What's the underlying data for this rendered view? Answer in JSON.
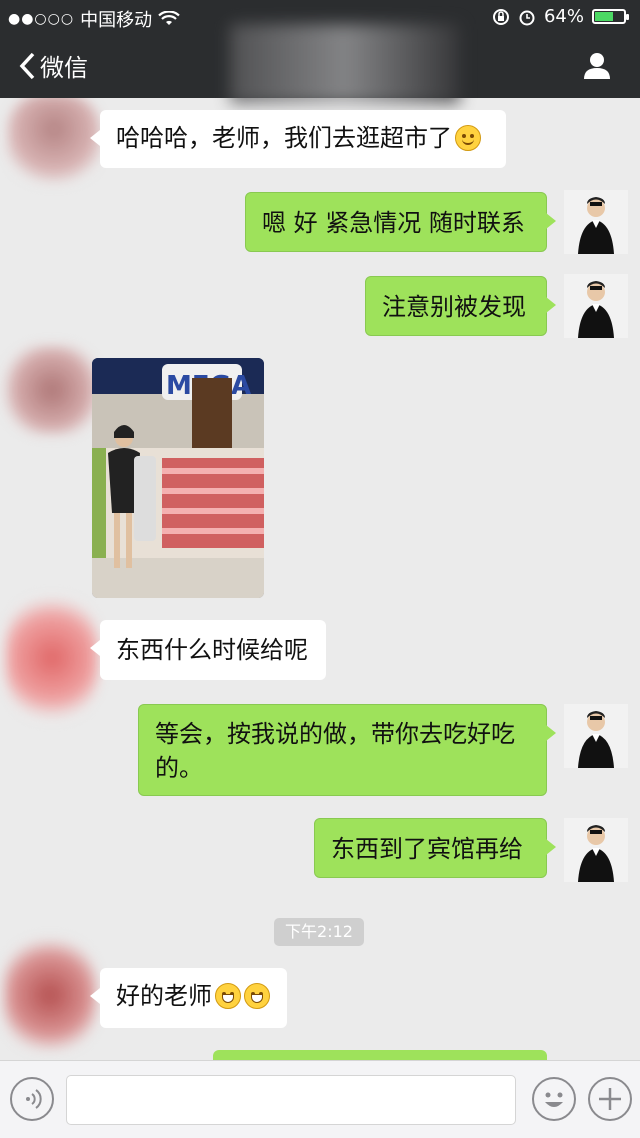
{
  "status": {
    "carrier": "中国移动",
    "time": "",
    "battery": "64%",
    "battery_level": 0.64
  },
  "nav": {
    "back_label": "微信"
  },
  "messages": [
    {
      "from": "them",
      "text": "哈哈哈，老师，我们去逛超市了",
      "emoji": "smile"
    },
    {
      "from": "me",
      "text": "嗯 好 紧急情况 随时联系"
    },
    {
      "from": "me",
      "text": "注意别被发现"
    },
    {
      "from": "them",
      "type": "image",
      "image_text": "MEGA"
    },
    {
      "from": "them",
      "text": "东西什么时候给呢"
    },
    {
      "from": "me",
      "text_line1": "等会，按我说的做，带你去吃好吃",
      "text_line2": "的。"
    },
    {
      "from": "me",
      "text": "东西到了宾馆再给"
    },
    {
      "from": "them",
      "text": "好的老师",
      "emoji": "grin"
    }
  ],
  "timestamp": "下午2:12",
  "colors": {
    "nav_bg": "#2b2d2f",
    "chat_bg": "#ebebeb",
    "outgoing_bubble": "#9ee25b",
    "incoming_bubble": "#ffffff"
  },
  "icons": {
    "back": "chevron-left-icon",
    "profile": "person-icon",
    "voice": "voice-icon",
    "emoji": "emoji-icon",
    "add": "plus-icon"
  }
}
